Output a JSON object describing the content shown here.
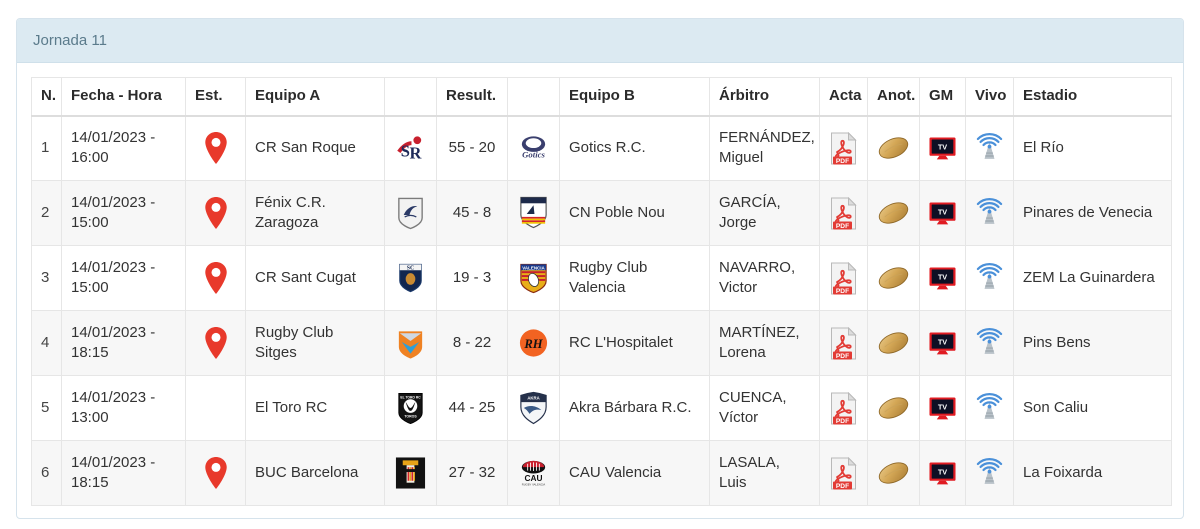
{
  "panel": {
    "title": "Jornada 11"
  },
  "table": {
    "headers": [
      {
        "key": "num",
        "label": "N."
      },
      {
        "key": "fecha",
        "label": "Fecha - Hora"
      },
      {
        "key": "est",
        "label": "Est."
      },
      {
        "key": "equipoa",
        "label": "Equipo A"
      },
      {
        "key": "logoa",
        "label": ""
      },
      {
        "key": "result",
        "label": "Result."
      },
      {
        "key": "logob",
        "label": ""
      },
      {
        "key": "equipob",
        "label": "Equipo B"
      },
      {
        "key": "arbitro",
        "label": "Árbitro"
      },
      {
        "key": "acta",
        "label": "Acta"
      },
      {
        "key": "anot",
        "label": "Anot."
      },
      {
        "key": "gm",
        "label": "GM"
      },
      {
        "key": "vivo",
        "label": "Vivo"
      },
      {
        "key": "estadio",
        "label": "Estadio"
      }
    ],
    "rows": [
      {
        "num": "1",
        "fecha": "14/01/2023 - 16:00",
        "has_pin": true,
        "equipo_a": "CR San Roque",
        "logo_a": "cr-san-roque-logo",
        "result": "55 - 20",
        "logo_b": "gotics-rc-logo",
        "equipo_b": "Gotics R.C.",
        "arbitro": "FERNÁNDEZ, Miguel",
        "acta": "pdf-icon",
        "anot": "rugby-ball-icon",
        "gm": "tv-icon",
        "vivo": "live-broadcast-icon",
        "estadio": "El Río"
      },
      {
        "num": "2",
        "fecha": "14/01/2023 - 15:00",
        "has_pin": true,
        "equipo_a": "Fénix C.R. Zaragoza",
        "logo_a": "fenix-cr-zaragoza-logo",
        "result": "45 - 8",
        "logo_b": "cn-poble-nou-logo",
        "equipo_b": "CN Poble Nou",
        "arbitro": "GARCÍA, Jorge",
        "acta": "pdf-icon",
        "anot": "rugby-ball-icon",
        "gm": "tv-icon",
        "vivo": "live-broadcast-icon",
        "estadio": "Pinares de Venecia"
      },
      {
        "num": "3",
        "fecha": "14/01/2023 - 15:00",
        "has_pin": true,
        "equipo_a": "CR Sant Cugat",
        "logo_a": "cr-sant-cugat-logo",
        "result": "19 - 3",
        "logo_b": "rugby-club-valencia-logo",
        "equipo_b": "Rugby Club Valencia",
        "arbitro": "NAVARRO, Victor",
        "acta": "pdf-icon",
        "anot": "rugby-ball-icon",
        "gm": "tv-icon",
        "vivo": "live-broadcast-icon",
        "estadio": "ZEM La Guinardera"
      },
      {
        "num": "4",
        "fecha": "14/01/2023 - 18:15",
        "has_pin": true,
        "equipo_a": "Rugby Club Sitges",
        "logo_a": "rugby-club-sitges-logo",
        "result": "8 - 22",
        "logo_b": "rc-lhospitalet-logo",
        "equipo_b": "RC L'Hospitalet",
        "arbitro": "MARTÍNEZ, Lorena",
        "acta": "pdf-icon",
        "anot": "rugby-ball-icon",
        "gm": "tv-icon",
        "vivo": "live-broadcast-icon",
        "estadio": "Pins Bens"
      },
      {
        "num": "5",
        "fecha": "14/01/2023 - 13:00",
        "has_pin": false,
        "equipo_a": "El Toro RC",
        "logo_a": "el-toro-rc-logo",
        "result": "44 - 25",
        "logo_b": "akra-barbara-rc-logo",
        "equipo_b": "Akra Bárbara R.C.",
        "arbitro": "CUENCA, Víctor",
        "acta": "pdf-icon",
        "anot": "rugby-ball-icon",
        "gm": "tv-icon",
        "vivo": "live-broadcast-icon",
        "estadio": "Son Caliu"
      },
      {
        "num": "6",
        "fecha": "14/01/2023 - 18:15",
        "has_pin": true,
        "equipo_a": "BUC Barcelona",
        "logo_a": "buc-barcelona-logo",
        "result": "27 - 32",
        "logo_b": "cau-valencia-logo",
        "equipo_b": "CAU Valencia",
        "arbitro": "LASALA, Luis",
        "acta": "pdf-icon",
        "anot": "rugby-ball-icon",
        "gm": "tv-icon",
        "vivo": "live-broadcast-icon",
        "estadio": "La Foixarda"
      }
    ]
  },
  "colors": {
    "panel_header_bg": "#dceaf2",
    "panel_header_text": "#5b7b8c",
    "pin": "#e8392b",
    "pdf_red": "#e23b35",
    "tv_red": "#e01b22",
    "live_blue": "#4a90d9",
    "row_stripe": "#f7f7f7"
  }
}
